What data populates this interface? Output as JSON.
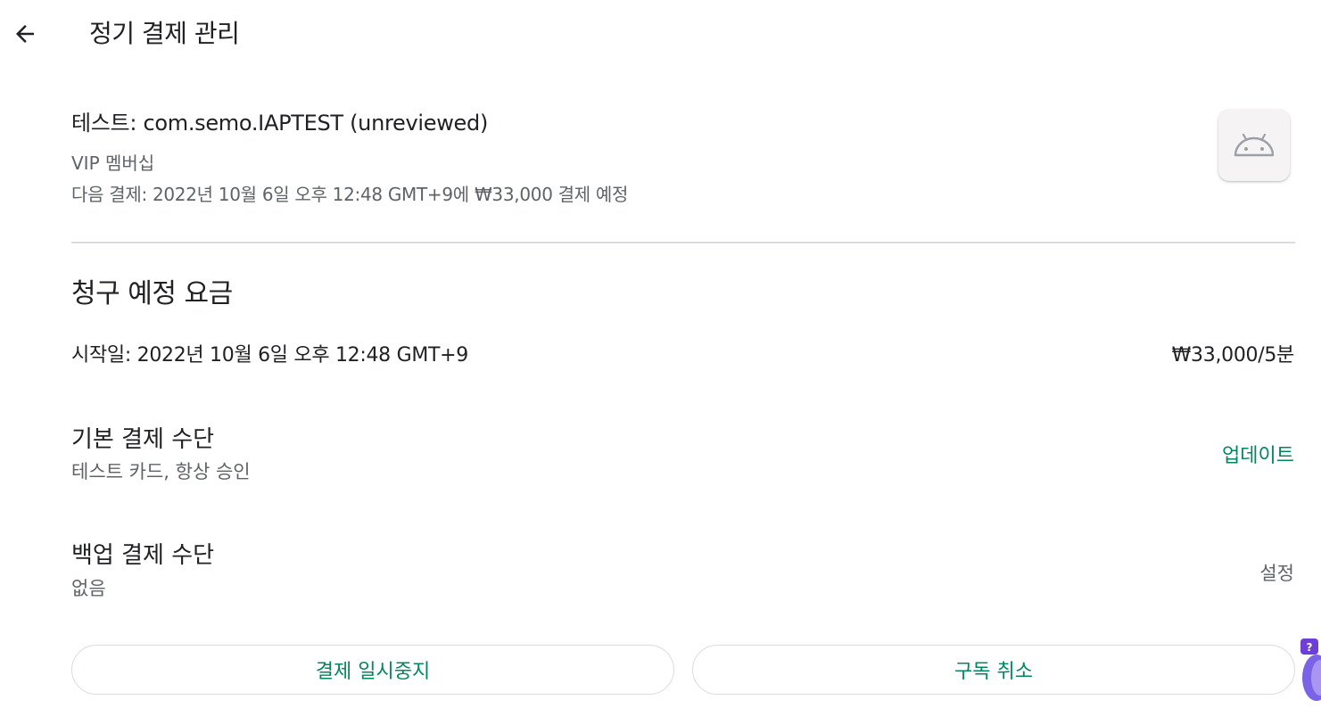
{
  "header": {
    "title": "정기 결제 관리"
  },
  "subscription": {
    "name": "테스트: com.semo.IAPTEST (unreviewed)",
    "plan": "VIP 멤버십",
    "next_payment": "다음 결제: 2022년 10월 6일 오후 12:48 GMT+9에 ₩33,000 결제 예정"
  },
  "billing": {
    "section_title": "청구 예정 요금",
    "start_date": "시작일: 2022년 10월 6일 오후 12:48 GMT+9",
    "price": "₩33,000/5분"
  },
  "primary_payment": {
    "title": "기본 결제 수단",
    "value": "테스트 카드, 항상 승인",
    "action_label": "업데이트"
  },
  "backup_payment": {
    "title": "백업 결제 수단",
    "value": "없음",
    "action_label": "설정"
  },
  "actions": {
    "pause_label": "결제 일시중지",
    "cancel_label": "구독 취소"
  },
  "colors": {
    "accent": "#01875f",
    "text_primary": "#202124",
    "text_secondary": "#5f6368",
    "divider": "#dadce0"
  },
  "icons": {
    "back": "arrow-left-icon",
    "app": "android-icon"
  }
}
